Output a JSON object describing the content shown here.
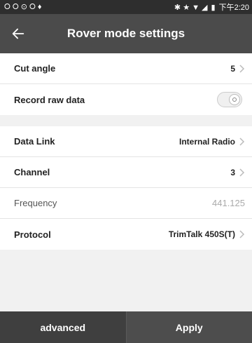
{
  "status_bar": {
    "left_icons": [
      "circle-arrow-icon",
      "circle-arrow-icon",
      "at-icon",
      "circle-arrow-icon",
      "pin-icon"
    ],
    "left_glyphs": "⭘ ⭘ ⊙ ⭘ ♦",
    "right_glyphs": "✱ ★ ▼ ◢",
    "time": "下午2:20"
  },
  "header": {
    "title": "Rover mode settings",
    "back_icon": "back-arrow-icon"
  },
  "settings": {
    "cut_angle": {
      "label": "Cut angle",
      "value": "5"
    },
    "record_raw": {
      "label": "Record raw data",
      "enabled": false
    },
    "data_link": {
      "label": "Data Link",
      "value": "Internal Radio"
    },
    "channel": {
      "label": "Channel",
      "value": "3"
    },
    "frequency": {
      "label": "Frequency",
      "value": "441.125"
    },
    "protocol": {
      "label": "Protocol",
      "value": "TrimTalk 450S(T)"
    }
  },
  "footer": {
    "advanced_label": "advanced",
    "apply_label": "Apply"
  },
  "colors": {
    "header_bg": "#4b4b4b",
    "page_bg": "#f1f1f1",
    "accent": "#ffffff"
  }
}
